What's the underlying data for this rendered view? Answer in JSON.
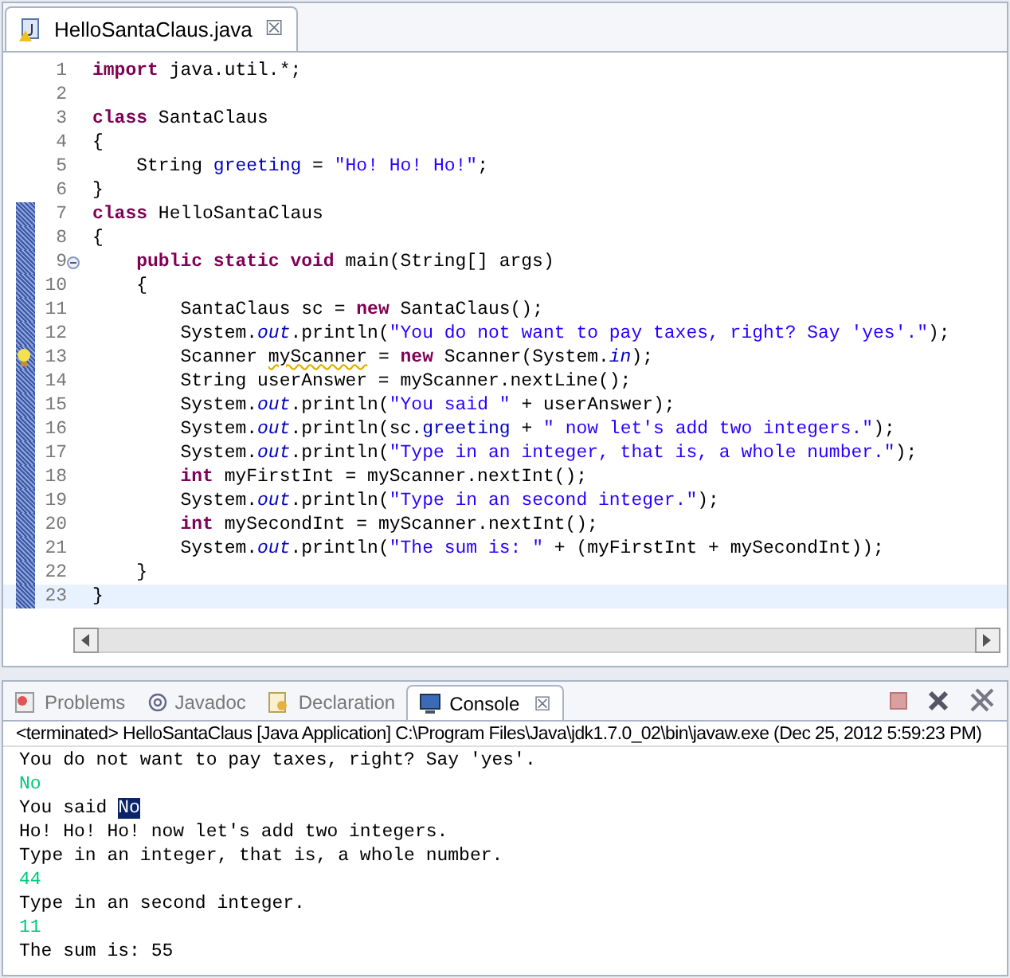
{
  "editor": {
    "tab": {
      "title": "HelloSantaClaus.java",
      "close": "☒",
      "selected": true
    },
    "lines": [
      {
        "number": "1",
        "changed": false,
        "current": false,
        "tokens": [
          {
            "kind": "keyword",
            "text": "import"
          },
          {
            "kind": "plain",
            "text": " java.util.*;"
          }
        ]
      },
      {
        "number": "2",
        "changed": false,
        "current": false
      },
      {
        "number": "3",
        "changed": false,
        "current": false,
        "tokens": [
          {
            "kind": "keyword",
            "text": "class"
          },
          {
            "kind": "plain",
            "text": " SantaClaus"
          }
        ]
      },
      {
        "number": "4",
        "changed": false,
        "current": false,
        "tokens": [
          {
            "kind": "plain",
            "text": "{"
          }
        ]
      },
      {
        "number": "5",
        "changed": false,
        "current": false,
        "tokens": [
          {
            "kind": "plain",
            "text": "    String "
          },
          {
            "kind": "field",
            "text": "greeting"
          },
          {
            "kind": "plain",
            "text": " = "
          },
          {
            "kind": "string",
            "text": "\"Ho! Ho! Ho!\""
          },
          {
            "kind": "plain",
            "text": ";"
          }
        ]
      },
      {
        "number": "6",
        "changed": false,
        "current": false,
        "tokens": [
          {
            "kind": "plain",
            "text": "}"
          }
        ]
      },
      {
        "number": "7",
        "changed": true,
        "current": false,
        "tokens": [
          {
            "kind": "keyword",
            "text": "class"
          },
          {
            "kind": "plain",
            "text": " HelloSantaClaus"
          }
        ]
      },
      {
        "number": "8",
        "changed": true,
        "current": false,
        "tokens": [
          {
            "kind": "plain",
            "text": "{"
          }
        ]
      },
      {
        "number": "9",
        "changed": true,
        "current": false,
        "fold": true,
        "tokens": [
          {
            "kind": "keyword",
            "text": "    public static void"
          },
          {
            "kind": "plain",
            "text": " main(String[] args)"
          }
        ]
      },
      {
        "number": "10",
        "changed": true,
        "current": false,
        "tokens": [
          {
            "kind": "plain",
            "text": "    {"
          }
        ]
      },
      {
        "number": "11",
        "changed": true,
        "current": false,
        "tokens": [
          {
            "kind": "plain",
            "text": "        SantaClaus sc = "
          },
          {
            "kind": "keyword",
            "text": "new"
          },
          {
            "kind": "plain",
            "text": " SantaClaus();"
          }
        ]
      },
      {
        "number": "12",
        "changed": true,
        "current": false,
        "tokens": [
          {
            "kind": "plain",
            "text": "        System."
          },
          {
            "kind": "static",
            "text": "out"
          },
          {
            "kind": "plain",
            "text": ".println("
          },
          {
            "kind": "string",
            "text": "\"You do not want to pay taxes, right? Say 'yes'.\""
          },
          {
            "kind": "plain",
            "text": ");"
          }
        ]
      },
      {
        "number": "13",
        "changed": true,
        "current": false,
        "warning": true,
        "tokens": [
          {
            "kind": "plain",
            "text": "        Scanner "
          },
          {
            "kind": "warning",
            "text": "myScanner"
          },
          {
            "kind": "plain",
            "text": " = "
          },
          {
            "kind": "keyword",
            "text": "new"
          },
          {
            "kind": "plain",
            "text": " Scanner(System."
          },
          {
            "kind": "static",
            "text": "in"
          },
          {
            "kind": "plain",
            "text": ");"
          }
        ]
      },
      {
        "number": "14",
        "changed": true,
        "current": false,
        "tokens": [
          {
            "kind": "plain",
            "text": "        String userAnswer = myScanner.nextLine();"
          }
        ]
      },
      {
        "number": "15",
        "changed": true,
        "current": false,
        "tokens": [
          {
            "kind": "plain",
            "text": "        System."
          },
          {
            "kind": "static",
            "text": "out"
          },
          {
            "kind": "plain",
            "text": ".println("
          },
          {
            "kind": "string",
            "text": "\"You said \""
          },
          {
            "kind": "plain",
            "text": " + userAnswer);"
          }
        ]
      },
      {
        "number": "16",
        "changed": true,
        "current": false,
        "tokens": [
          {
            "kind": "plain",
            "text": "        System."
          },
          {
            "kind": "static",
            "text": "out"
          },
          {
            "kind": "plain",
            "text": ".println(sc."
          },
          {
            "kind": "field",
            "text": "greeting"
          },
          {
            "kind": "plain",
            "text": " + "
          },
          {
            "kind": "string",
            "text": "\" now let's add two integers.\""
          },
          {
            "kind": "plain",
            "text": ");"
          }
        ]
      },
      {
        "number": "17",
        "changed": true,
        "current": false,
        "tokens": [
          {
            "kind": "plain",
            "text": "        System."
          },
          {
            "kind": "static",
            "text": "out"
          },
          {
            "kind": "plain",
            "text": ".println("
          },
          {
            "kind": "string",
            "text": "\"Type in an integer, that is, a whole number.\""
          },
          {
            "kind": "plain",
            "text": ");"
          }
        ]
      },
      {
        "number": "18",
        "changed": true,
        "current": false,
        "tokens": [
          {
            "kind": "keyword",
            "text": "        int"
          },
          {
            "kind": "plain",
            "text": " myFirstInt = myScanner.nextInt();"
          }
        ]
      },
      {
        "number": "19",
        "changed": true,
        "current": false,
        "tokens": [
          {
            "kind": "plain",
            "text": "        System."
          },
          {
            "kind": "static",
            "text": "out"
          },
          {
            "kind": "plain",
            "text": ".println("
          },
          {
            "kind": "string",
            "text": "\"Type in an second integer.\""
          },
          {
            "kind": "plain",
            "text": ");"
          }
        ]
      },
      {
        "number": "20",
        "changed": true,
        "current": false,
        "tokens": [
          {
            "kind": "keyword",
            "text": "        int"
          },
          {
            "kind": "plain",
            "text": " mySecondInt = myScanner.nextInt();"
          }
        ]
      },
      {
        "number": "21",
        "changed": true,
        "current": false,
        "tokens": [
          {
            "kind": "plain",
            "text": "        System."
          },
          {
            "kind": "static",
            "text": "out"
          },
          {
            "kind": "plain",
            "text": ".println("
          },
          {
            "kind": "string",
            "text": "\"The sum is: \""
          },
          {
            "kind": "plain",
            "text": " + (myFirstInt + mySecondInt));"
          }
        ]
      },
      {
        "number": "22",
        "changed": true,
        "current": false,
        "tokens": [
          {
            "kind": "plain",
            "text": "    }"
          }
        ]
      },
      {
        "number": "23",
        "changed": true,
        "current": true,
        "tokens": [
          {
            "kind": "plain",
            "text": "}"
          }
        ]
      }
    ]
  },
  "bottom_panel": {
    "tabs": [
      {
        "label": "Problems",
        "selected": false
      },
      {
        "label": "Javadoc",
        "selected": false
      },
      {
        "label": "Declaration",
        "selected": false
      },
      {
        "label": "Console",
        "selected": true,
        "close": "☒"
      }
    ],
    "status": "<terminated> HelloSantaClaus [Java Application] C:\\Program Files\\Java\\jdk1.7.0_02\\bin\\javaw.exe (Dec 25, 2012 5:59:23 PM)",
    "console": [
      {
        "kind": "output",
        "segments": [
          {
            "text": "You do not want to pay taxes, right? Say 'yes'.",
            "selected": false
          }
        ]
      },
      {
        "kind": "input",
        "segments": [
          {
            "text": "No",
            "selected": false
          }
        ]
      },
      {
        "kind": "output",
        "segments": [
          {
            "text": "You said ",
            "selected": false
          },
          {
            "text": "No",
            "selected": true
          }
        ]
      },
      {
        "kind": "output",
        "segments": [
          {
            "text": "Ho! Ho! Ho! now let's add two integers.",
            "selected": false
          }
        ]
      },
      {
        "kind": "output",
        "segments": [
          {
            "text": "Type in an integer, that is, a whole number.",
            "selected": false
          }
        ]
      },
      {
        "kind": "input",
        "segments": [
          {
            "text": "44",
            "selected": false
          }
        ]
      },
      {
        "kind": "output",
        "segments": [
          {
            "text": "Type in an second integer.",
            "selected": false
          }
        ]
      },
      {
        "kind": "input",
        "segments": [
          {
            "text": "11",
            "selected": false
          }
        ]
      },
      {
        "kind": "output",
        "segments": [
          {
            "text": "The sum is: 55",
            "selected": false
          }
        ]
      }
    ]
  }
}
